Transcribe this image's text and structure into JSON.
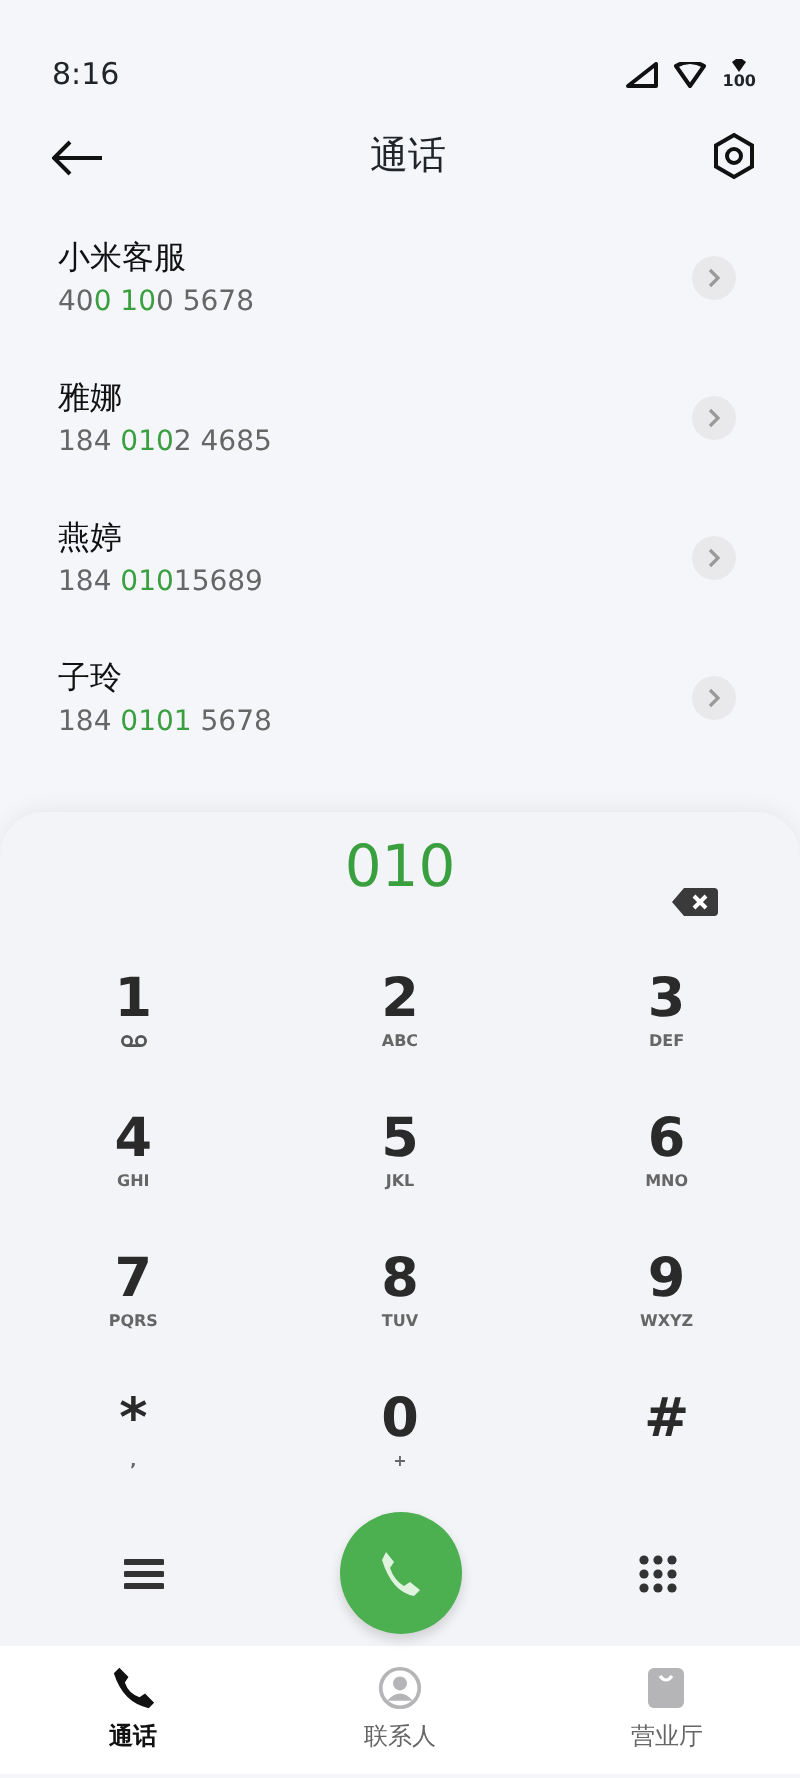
{
  "status_bar": {
    "time": "8:16",
    "battery": "100"
  },
  "header": {
    "title": "通话"
  },
  "contacts": [
    {
      "name": "小米客服",
      "number_parts": [
        {
          "text": "40",
          "match": false
        },
        {
          "text": "0 10",
          "match": true
        },
        {
          "text": "0 5678",
          "match": false
        }
      ]
    },
    {
      "name": "雅娜",
      "number_parts": [
        {
          "text": "184 ",
          "match": false
        },
        {
          "text": "010",
          "match": true
        },
        {
          "text": "2 4685",
          "match": false
        }
      ]
    },
    {
      "name": "燕婷",
      "number_parts": [
        {
          "text": "184 ",
          "match": false
        },
        {
          "text": "010",
          "match": true
        },
        {
          "text": "15689",
          "match": false
        }
      ]
    },
    {
      "name": "子玲",
      "number_parts": [
        {
          "text": "184 ",
          "match": false
        },
        {
          "text": "0101",
          "match": true
        },
        {
          "text": " 5678",
          "match": false
        }
      ]
    }
  ],
  "dialed": "010",
  "keys": [
    {
      "digit": "1",
      "kind": "voicemail"
    },
    {
      "digit": "2",
      "letters": "ABC",
      "kind": "text"
    },
    {
      "digit": "3",
      "letters": "DEF",
      "kind": "text"
    },
    {
      "digit": "4",
      "letters": "GHI",
      "kind": "text"
    },
    {
      "digit": "5",
      "letters": "JKL",
      "kind": "text"
    },
    {
      "digit": "6",
      "letters": "MNO",
      "kind": "text"
    },
    {
      "digit": "7",
      "letters": "PQRS",
      "kind": "text"
    },
    {
      "digit": "8",
      "letters": "TUV",
      "kind": "text"
    },
    {
      "digit": "9",
      "letters": "WXYZ",
      "kind": "text"
    },
    {
      "digit": "*",
      "letters": ",",
      "kind": "text"
    },
    {
      "digit": "0",
      "letters": "+",
      "kind": "text"
    },
    {
      "digit": "#",
      "kind": "none"
    }
  ],
  "tabs": [
    {
      "label": "通话",
      "kind": "phone",
      "selected": true
    },
    {
      "label": "联系人",
      "kind": "person",
      "selected": false
    },
    {
      "label": "营业厅",
      "kind": "bag",
      "selected": false
    }
  ]
}
